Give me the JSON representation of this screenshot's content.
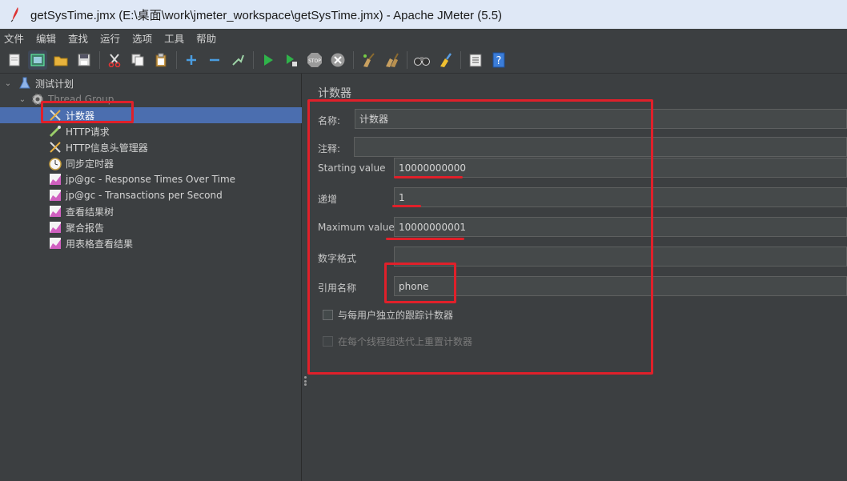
{
  "window": {
    "title": "getSysTime.jmx (E:\\桌面\\work\\jmeter_workspace\\getSysTime.jmx) - Apache JMeter (5.5)"
  },
  "menu": [
    "文件",
    "编辑",
    "查找",
    "运行",
    "选项",
    "工具",
    "帮助"
  ],
  "toolbar": {
    "icons": [
      "new-icon",
      "templates-icon",
      "open-icon",
      "save-icon",
      "cut-icon",
      "copy-icon",
      "paste-icon",
      "expand-icon",
      "collapse-icon",
      "toggle-icon",
      "start-icon",
      "start-no-pause-icon",
      "stop-icon",
      "shutdown-icon",
      "clear-icon",
      "clear-all-icon",
      "search-icon",
      "reset-search-icon",
      "function-helper-icon",
      "help-icon"
    ]
  },
  "tree": {
    "items": [
      {
        "label": "测试计划",
        "icon": "test-plan-icon"
      },
      {
        "label": "Thread Group",
        "icon": "thread-group-icon"
      },
      {
        "label": "计数器",
        "icon": "counter-icon"
      },
      {
        "label": "HTTP请求",
        "icon": "http-request-icon"
      },
      {
        "label": "HTTP信息头管理器",
        "icon": "header-manager-icon"
      },
      {
        "label": "同步定时器",
        "icon": "timer-icon"
      },
      {
        "label": "jp@gc - Response Times Over Time",
        "icon": "graph-icon"
      },
      {
        "label": "jp@gc - Transactions per Second",
        "icon": "graph-icon"
      },
      {
        "label": "查看结果树",
        "icon": "graph-icon"
      },
      {
        "label": "聚合报告",
        "icon": "graph-icon"
      },
      {
        "label": "用表格查看结果",
        "icon": "graph-icon"
      }
    ]
  },
  "panel": {
    "title": "计数器",
    "name_label": "名称:",
    "name_value": "计数器",
    "comment_label": "注释:",
    "comment_value": "",
    "start_label": "Starting value",
    "start_value": "10000000000",
    "increment_label": "递增",
    "increment_value": "1",
    "max_label": "Maximum value",
    "max_value": "10000000001",
    "format_label": "数字格式",
    "format_value": "",
    "ref_label": "引用名称",
    "ref_value": "phone",
    "per_user_label": "与每用户独立的跟踪计数器",
    "per_user_checked": false,
    "reset_label": "在每个线程组迭代上重置计数器",
    "reset_checked": false
  },
  "colors": {
    "annotation": "#e0202a",
    "selection": "#4b6eaf",
    "background": "#3c3f41"
  }
}
